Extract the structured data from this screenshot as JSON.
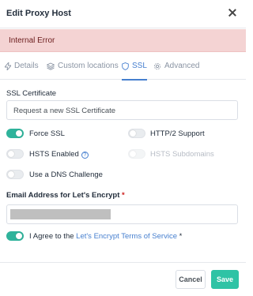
{
  "modal": {
    "title": "Edit Proxy Host"
  },
  "alert": {
    "text": "Internal Error"
  },
  "tabs": [
    {
      "label": "Details",
      "icon": "lightning-icon"
    },
    {
      "label": "Custom locations",
      "icon": "layers-icon"
    },
    {
      "label": "SSL",
      "icon": "shield-icon",
      "active": true
    },
    {
      "label": "Advanced",
      "icon": "gear-icon"
    }
  ],
  "ssl": {
    "certificate_label": "SSL Certificate",
    "certificate_value": "Request a new SSL Certificate",
    "force_ssl": {
      "label": "Force SSL",
      "on": true
    },
    "http2": {
      "label": "HTTP/2 Support",
      "on": false
    },
    "hsts_enabled": {
      "label": "HSTS Enabled",
      "on": false
    },
    "hsts_subdomains": {
      "label": "HSTS Subdomains",
      "on": false,
      "disabled": true
    },
    "dns_challenge": {
      "label": "Use a DNS Challenge",
      "on": false
    },
    "email_label": "Email Address for Let's Encrypt",
    "required_mark": "*",
    "agree": {
      "prefix": "I Agree to the",
      "link": "Let's Encrypt Terms of Service",
      "suffix": "*",
      "on": true
    }
  },
  "footer": {
    "cancel_label": "Cancel",
    "save_label": "Save"
  },
  "colors": {
    "accent": "#467fcf",
    "toggle_on": "#2fb39b",
    "save": "#2fc3a5",
    "alert_bg": "#f4d3d3"
  }
}
